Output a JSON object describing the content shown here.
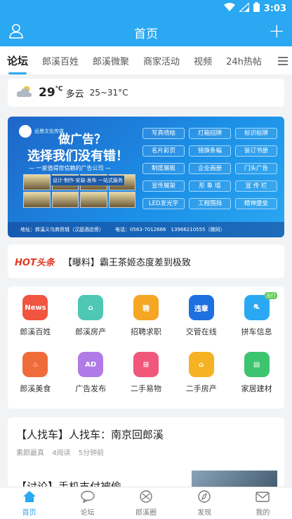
{
  "status": {
    "time": "3:03"
  },
  "header": {
    "title": "首页"
  },
  "tabs": [
    {
      "label": "论坛",
      "active": true
    },
    {
      "label": "郎溪百姓"
    },
    {
      "label": "郎溪微聚"
    },
    {
      "label": "商家活动"
    },
    {
      "label": "视频"
    },
    {
      "label": "24h热帖"
    }
  ],
  "weather": {
    "temp": "29",
    "unit": "℃",
    "condition": "多云",
    "range": "25~31°C"
  },
  "banner": {
    "company": "远景文化传媒",
    "headline1": "做广告？",
    "headline2": "选择我们没有错！",
    "tagline": "— 一家值得您信赖的广告公司 —",
    "slogan": "设计·制作·安装·发布 一站式服务",
    "services": [
      "写真喷绘",
      "灯箱招牌",
      "标识标牌",
      "名片彩页",
      "锦旗条幅",
      "装订书册",
      "制度展板",
      "企业画册",
      "门头广告",
      "宣传展架",
      "形 象 墙",
      "宣 传 栏",
      "LED发光字",
      "工程围挡",
      "精神堡垒"
    ],
    "address": "地址：郎溪义乌商贸城（汉庭酒店旁）",
    "phone": "电话：0563-7012666　13966210555（微同）"
  },
  "hot": {
    "logo": "HOT头条",
    "text": "【曝料】霸王茶姬态度差到极致"
  },
  "grid": [
    {
      "label": "郎溪百姓",
      "icon": "news-icon",
      "color": "#f0553f",
      "glyph": "News"
    },
    {
      "label": "郎溪房产",
      "icon": "house-icon",
      "color": "#4fc7b5",
      "glyph": "⌂"
    },
    {
      "label": "招聘求职",
      "icon": "hire-icon",
      "color": "#f5a623",
      "glyph": "聘"
    },
    {
      "label": "交管在线",
      "icon": "traffic-icon",
      "color": "#1e6fe0",
      "glyph": "违章"
    },
    {
      "label": "拼车信息",
      "icon": "carpool-icon",
      "color": "#2aa8f2",
      "glyph": "⛐",
      "badge": "出行"
    },
    {
      "label": "郎溪美食",
      "icon": "food-icon",
      "color": "#f06b3a",
      "glyph": "♨"
    },
    {
      "label": "广告发布",
      "icon": "ad-icon",
      "color": "#b07be6",
      "glyph": "AD"
    },
    {
      "label": "二手易物",
      "icon": "gift-icon",
      "color": "#f0577a",
      "glyph": "⊞"
    },
    {
      "label": "二手房产",
      "icon": "home-icon",
      "color": "#f5b223",
      "glyph": "⌂"
    },
    {
      "label": "家居建材",
      "icon": "paint-icon",
      "color": "#3cc46e",
      "glyph": "▤"
    }
  ],
  "feed": [
    {
      "title": "【人找车】人找车：南京回郎溪",
      "author": "素颜最真",
      "reads": "4阅读",
      "time": "5分钟前"
    },
    {
      "title": "【讨论】手机支付被偷"
    }
  ],
  "nav": [
    {
      "label": "首页",
      "icon": "home-icon",
      "active": true
    },
    {
      "label": "论坛",
      "icon": "chat-icon"
    },
    {
      "label": "郎溪圈",
      "icon": "circle-icon"
    },
    {
      "label": "发现",
      "icon": "compass-icon"
    },
    {
      "label": "我的",
      "icon": "mail-icon"
    }
  ],
  "colors": {
    "accent": "#2aa8f2",
    "hot": "#e03a26"
  }
}
